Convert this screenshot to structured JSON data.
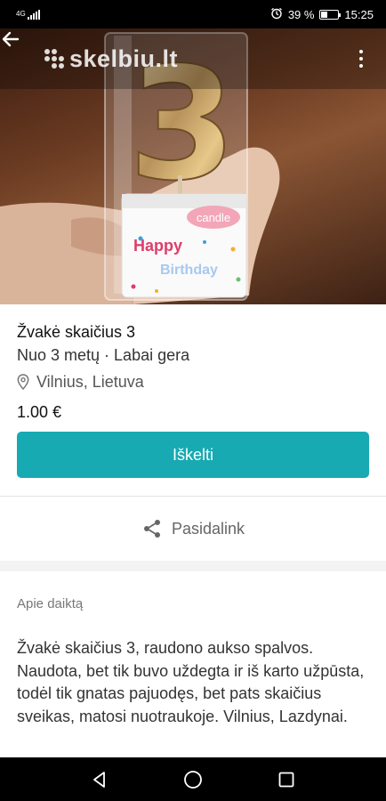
{
  "status_bar": {
    "network": "4G",
    "battery_percent": "39 %",
    "battery_level": 0.39,
    "time": "15:25"
  },
  "app_bar": {
    "logo_text": "skelbiu.lt",
    "back_icon": "arrow-left-icon",
    "more_icon": "more-vertical-icon"
  },
  "hero": {
    "candle_number": "3",
    "package_label": "candle",
    "package_text_1": "Happy",
    "package_text_2": "Birthday"
  },
  "listing": {
    "title": "Žvakė skaičius 3",
    "subtitle": "Nuo 3 metų · Labai gera",
    "location": "Vilnius, Lietuva",
    "price": "1.00 €"
  },
  "actions": {
    "promote_label": "Iškelti",
    "share_label": "Pasidalink"
  },
  "about": {
    "label": "Apie daiktą",
    "description": "Žvakė skaičius 3, raudono aukso spalvos. Naudota, bet tik buvo uždegta ir iš karto užpūsta, todėl tik gnatas pajuodęs, bet pats skaičius sveikas, matosi nuotraukoje. Vilnius, Lazdynai."
  },
  "colors": {
    "accent": "#18aab2",
    "status_bar": "#000000"
  }
}
